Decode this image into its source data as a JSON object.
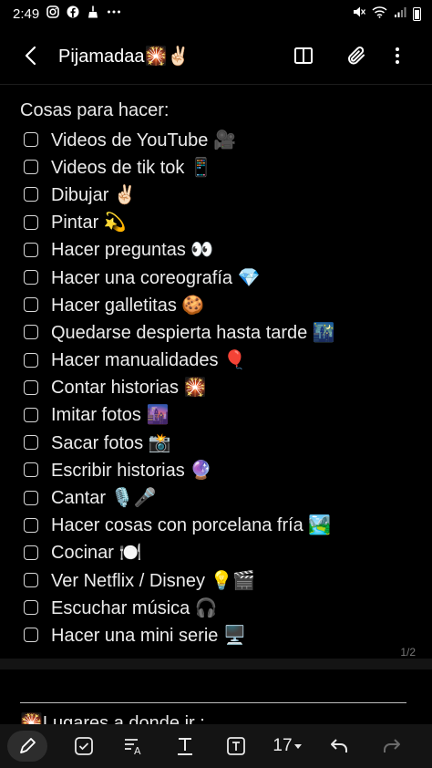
{
  "status_bar": {
    "time": "2:49"
  },
  "app_bar": {
    "title": "Pijamadaa🎇✌🏻"
  },
  "note": {
    "section_title": "Cosas para hacer:",
    "items": [
      "Videos de YouTube 🎥",
      "Videos de tik tok 📱",
      "Dibujar ✌🏻",
      "Pintar 💫",
      "Hacer preguntas 👀",
      "Hacer una coreografía 💎",
      "Hacer galletitas 🍪",
      "Quedarse despierta hasta tarde 🌃",
      "Hacer manualidades 🎈",
      "Contar historias 🎇",
      "Imitar fotos 🌆",
      "Sacar fotos 📸",
      "Escribir historias 🔮",
      "Cantar 🎙️🎤",
      "Hacer cosas con porcelana fría 🏞️",
      "Cocinar 🍽️",
      "Ver Netflix / Disney 💡🎬",
      "Escuchar música 🎧",
      "Hacer una mini serie 🖥️"
    ],
    "page_indicator": "1/2",
    "page2_partial_text": "🎇Lugares a donde ir :"
  },
  "toolbar": {
    "font_size": "17"
  },
  "icons": {
    "status": [
      "instagram-icon",
      "facebook-icon",
      "broom-icon",
      "more-icon",
      "mute-icon",
      "wifi-icon",
      "signal-icon",
      "battery-icon"
    ],
    "app_bar": [
      "back-arrow-icon",
      "book-view-icon",
      "attachment-icon",
      "more-vert-icon"
    ],
    "toolbar": [
      "pen-icon",
      "checkbox-icon",
      "text-style-icon",
      "text-format-icon",
      "text-box-icon",
      "dropdown-icon",
      "undo-icon",
      "redo-icon"
    ]
  }
}
